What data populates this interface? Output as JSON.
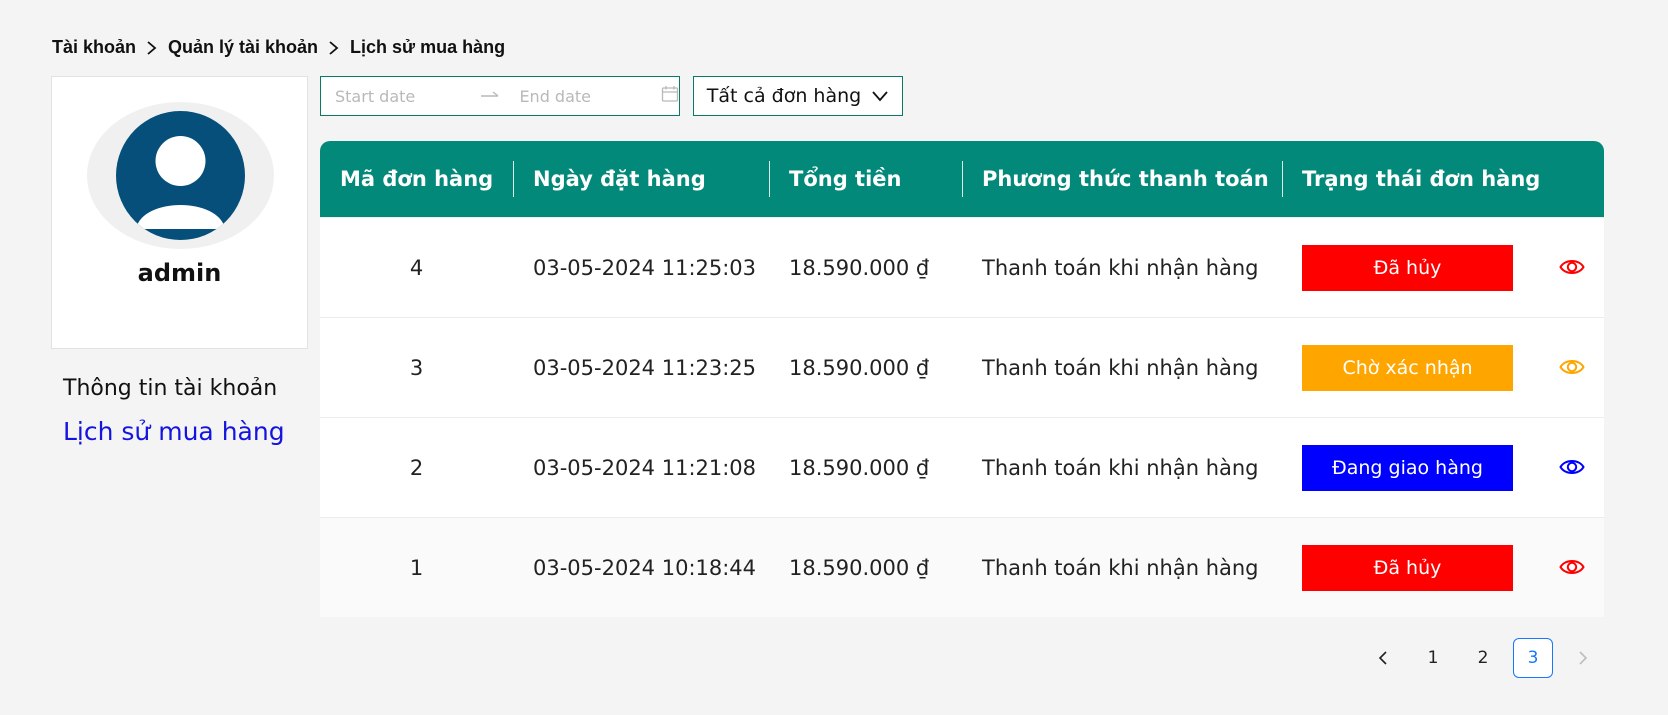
{
  "breadcrumb": [
    "Tài khoản",
    "Quản lý tài khoản",
    "Lịch sử mua hàng"
  ],
  "profile": {
    "username": "admin",
    "avatar_icon": "user-avatar-icon"
  },
  "side_menu": {
    "items": [
      {
        "label": "Thông tin tài khoản",
        "active": false
      },
      {
        "label": "Lịch sử mua hàng",
        "active": true
      }
    ]
  },
  "filters": {
    "start_date_placeholder": "Start date",
    "end_date_placeholder": "End date",
    "status_selected": "Tất cả đơn hàng"
  },
  "table": {
    "columns": [
      "Mã đơn hàng",
      "Ngày đặt hàng",
      "Tổng tiền",
      "Phương thức thanh toán",
      "Trạng thái đơn hàng"
    ],
    "rows": [
      {
        "id": "4",
        "date": "03-05-2024 11:25:03",
        "total": "18.590.000 ₫",
        "payment": "Thanh toán khi nhận hàng",
        "status": "Đã hủy",
        "status_color": "#ff0000"
      },
      {
        "id": "3",
        "date": "03-05-2024 11:23:25",
        "total": "18.590.000 ₫",
        "payment": "Thanh toán khi nhận hàng",
        "status": "Chờ xác nhận",
        "status_color": "#ffa500"
      },
      {
        "id": "2",
        "date": "03-05-2024 11:21:08",
        "total": "18.590.000 ₫",
        "payment": "Thanh toán khi nhận hàng",
        "status": "Đang giao hàng",
        "status_color": "#0000ff"
      },
      {
        "id": "1",
        "date": "03-05-2024 10:18:44",
        "total": "18.590.000 ₫",
        "payment": "Thanh toán khi nhận hàng",
        "status": "Đã hủy",
        "status_color": "#ff0000"
      }
    ]
  },
  "pagination": {
    "pages": [
      "1",
      "2",
      "3"
    ],
    "current": "3"
  },
  "colors": {
    "header": "#03897a",
    "accent_link": "#1414e0",
    "page_active": "#1677ff"
  }
}
